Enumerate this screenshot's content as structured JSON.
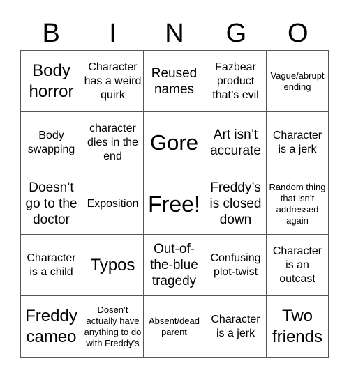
{
  "header": {
    "letters": [
      "B",
      "I",
      "N",
      "G",
      "O"
    ]
  },
  "cells": [
    {
      "text": "Body horror",
      "size": "s-l"
    },
    {
      "text": "Character has a weird quirk",
      "size": "s-s"
    },
    {
      "text": "Reused names",
      "size": "s-m"
    },
    {
      "text": "Fazbear product that’s evil",
      "size": "s-s"
    },
    {
      "text": "Vague/abrupt ending",
      "size": "s-xs"
    },
    {
      "text": "Body swapping",
      "size": "s-s"
    },
    {
      "text": "character dies in the end",
      "size": "s-s"
    },
    {
      "text": "Gore",
      "size": "s-xl"
    },
    {
      "text": "Art isn’t accurate",
      "size": "s-m"
    },
    {
      "text": "Character is a jerk",
      "size": "s-s"
    },
    {
      "text": "Doesn’t go to the doctor",
      "size": "s-m"
    },
    {
      "text": "Exposition",
      "size": "s-s"
    },
    {
      "text": "Free!",
      "size": "s-free"
    },
    {
      "text": "Freddy’s is closed down",
      "size": "s-m"
    },
    {
      "text": "Random thing that isn’t addressed again",
      "size": "s-xs"
    },
    {
      "text": "Character is a child",
      "size": "s-s"
    },
    {
      "text": "Typos",
      "size": "s-l"
    },
    {
      "text": "Out-of-the-blue tragedy",
      "size": "s-m"
    },
    {
      "text": "Confusing plot-twist",
      "size": "s-s"
    },
    {
      "text": "Character is an outcast",
      "size": "s-s"
    },
    {
      "text": "Freddy cameo",
      "size": "s-l"
    },
    {
      "text": "Dosen’t actually have anything to do with Freddy’s",
      "size": "s-xs"
    },
    {
      "text": "Absent/dead parent",
      "size": "s-xs"
    },
    {
      "text": "Character is a jerk",
      "size": "s-s"
    },
    {
      "text": "Two friends",
      "size": "s-l"
    }
  ]
}
